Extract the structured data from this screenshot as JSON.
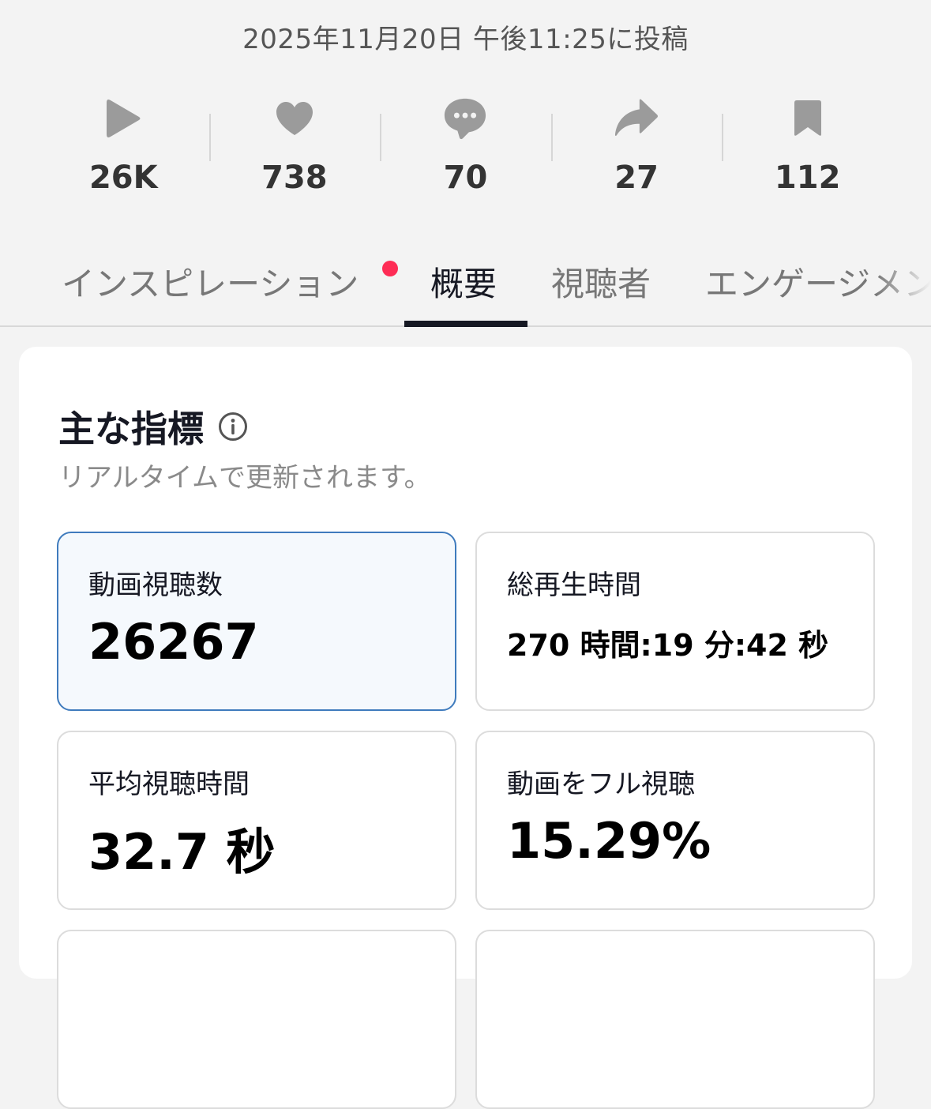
{
  "post": {
    "date_text": "2025年11月20日 午後11:25に投稿"
  },
  "stats": [
    {
      "icon": "play-icon",
      "value": "26K"
    },
    {
      "icon": "heart-icon",
      "value": "738"
    },
    {
      "icon": "comment-icon",
      "value": "70"
    },
    {
      "icon": "share-icon",
      "value": "27"
    },
    {
      "icon": "bookmark-icon",
      "value": "112"
    }
  ],
  "tabs": [
    {
      "label": "インスピレーション",
      "has_notification": true
    },
    {
      "label": "概要",
      "active": true
    },
    {
      "label": "視聴者"
    },
    {
      "label": "エンゲージメント"
    }
  ],
  "key_metrics": {
    "title": "主な指標",
    "subtitle": "リアルタイムで更新されます。",
    "cards": [
      {
        "label": "動画視聴数",
        "value": "26267",
        "selected": true
      },
      {
        "label": "総再生時間",
        "value": "270 時間:19 分:42 秒"
      },
      {
        "label": "平均視聴時間",
        "value": "32.7 秒"
      },
      {
        "label": "動画をフル視聴",
        "value": "15.29%"
      }
    ]
  },
  "colors": {
    "background": "#f3f3f3",
    "icon_gray": "#9b9b9b",
    "notification_dot": "#fe2c55",
    "selected_border": "#3f7bbd",
    "selected_bg": "#f5f9fd"
  }
}
